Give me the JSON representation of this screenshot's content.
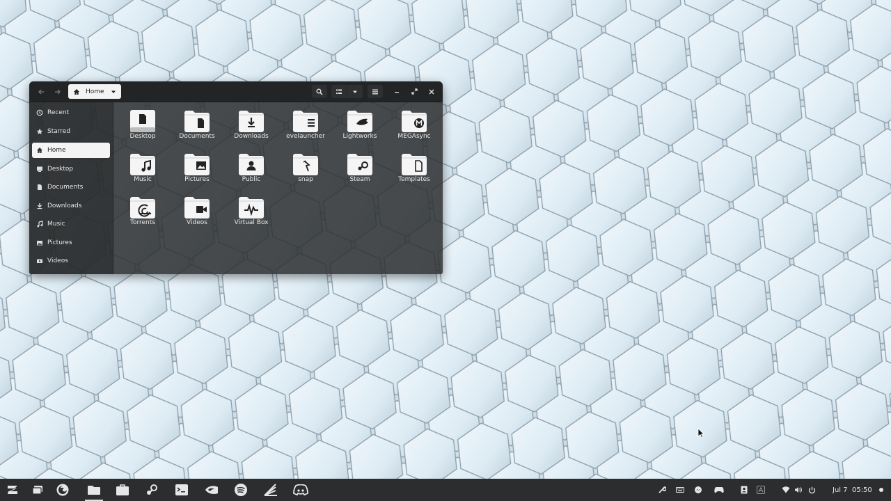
{
  "window": {
    "path": {
      "label": "Home",
      "icon": "home-icon"
    },
    "toolbar": {
      "back_icon": "arrow-left-icon",
      "forward_icon": "arrow-right-icon",
      "search_icon": "search-icon",
      "view_icon": "list-view-icon",
      "view_menu_icon": "chevron-down-icon",
      "menu_icon": "hamburger-menu-icon",
      "minimize_icon": "minimize-icon",
      "maximize_icon": "maximize-icon",
      "close_icon": "close-icon"
    },
    "sidebar": {
      "items": [
        {
          "label": "Recent",
          "icon": "clock-icon",
          "active": false
        },
        {
          "label": "Starred",
          "icon": "star-icon",
          "active": false
        },
        {
          "label": "Home",
          "icon": "home-icon",
          "active": true
        },
        {
          "label": "Desktop",
          "icon": "desktop-icon",
          "active": false
        },
        {
          "label": "Documents",
          "icon": "document-icon",
          "active": false
        },
        {
          "label": "Downloads",
          "icon": "download-icon",
          "active": false
        },
        {
          "label": "Music",
          "icon": "music-icon",
          "active": false
        },
        {
          "label": "Pictures",
          "icon": "picture-icon",
          "active": false
        },
        {
          "label": "Videos",
          "icon": "video-icon",
          "active": false
        }
      ]
    },
    "files": [
      {
        "name": "Desktop",
        "icon": "desktop-folder-icon"
      },
      {
        "name": "Documents",
        "icon": "documents-folder-icon"
      },
      {
        "name": "Downloads",
        "icon": "downloads-folder-icon"
      },
      {
        "name": "evelauncher",
        "icon": "list-folder-icon"
      },
      {
        "name": "Lightworks",
        "icon": "shark-folder-icon"
      },
      {
        "name": "MEGAsync",
        "icon": "mega-folder-icon"
      },
      {
        "name": "Music",
        "icon": "music-folder-icon"
      },
      {
        "name": "Pictures",
        "icon": "pictures-folder-icon"
      },
      {
        "name": "Public",
        "icon": "public-folder-icon"
      },
      {
        "name": "snap",
        "icon": "snap-folder-icon"
      },
      {
        "name": "Steam",
        "icon": "steam-folder-icon"
      },
      {
        "name": "Templates",
        "icon": "templates-folder-icon"
      },
      {
        "name": "Torrents",
        "icon": "torrents-folder-icon"
      },
      {
        "name": "Videos",
        "icon": "videos-folder-icon"
      },
      {
        "name": "Virtual Box",
        "icon": "virtualbox-folder-icon"
      }
    ]
  },
  "taskbar": {
    "apps": [
      {
        "name": "zorin-menu-icon"
      },
      {
        "name": "workspaces-icon"
      },
      {
        "name": "firefox-icon"
      },
      {
        "name": "files-icon",
        "active": true
      },
      {
        "name": "software-store-icon"
      },
      {
        "name": "steam-icon"
      },
      {
        "name": "terminal-icon"
      },
      {
        "name": "nvidia-icon"
      },
      {
        "name": "spotify-icon"
      },
      {
        "name": "lightworks-icon"
      },
      {
        "name": "discord-icon"
      }
    ],
    "tray": [
      {
        "name": "wrench-icon"
      },
      {
        "name": "keyboard-icon"
      },
      {
        "name": "messenger-icon"
      },
      {
        "name": "gamepad-icon"
      },
      {
        "name": "contact-icon"
      },
      {
        "name": "font-icon"
      },
      {
        "name": "wifi-icon"
      },
      {
        "name": "volume-icon"
      },
      {
        "name": "power-icon"
      }
    ],
    "clock": "Jul 7  05:50",
    "notification_icon": "notification-dot-icon"
  },
  "colors": {
    "window_bg": "#2c2e30",
    "titlebar_bg": "#232425",
    "taskbar_bg": "#2c2d2e",
    "active_item_bg": "#f4f4f4",
    "wallpaper_light": "#e4f0f8",
    "wallpaper_shadow": "#8fa6b3"
  }
}
